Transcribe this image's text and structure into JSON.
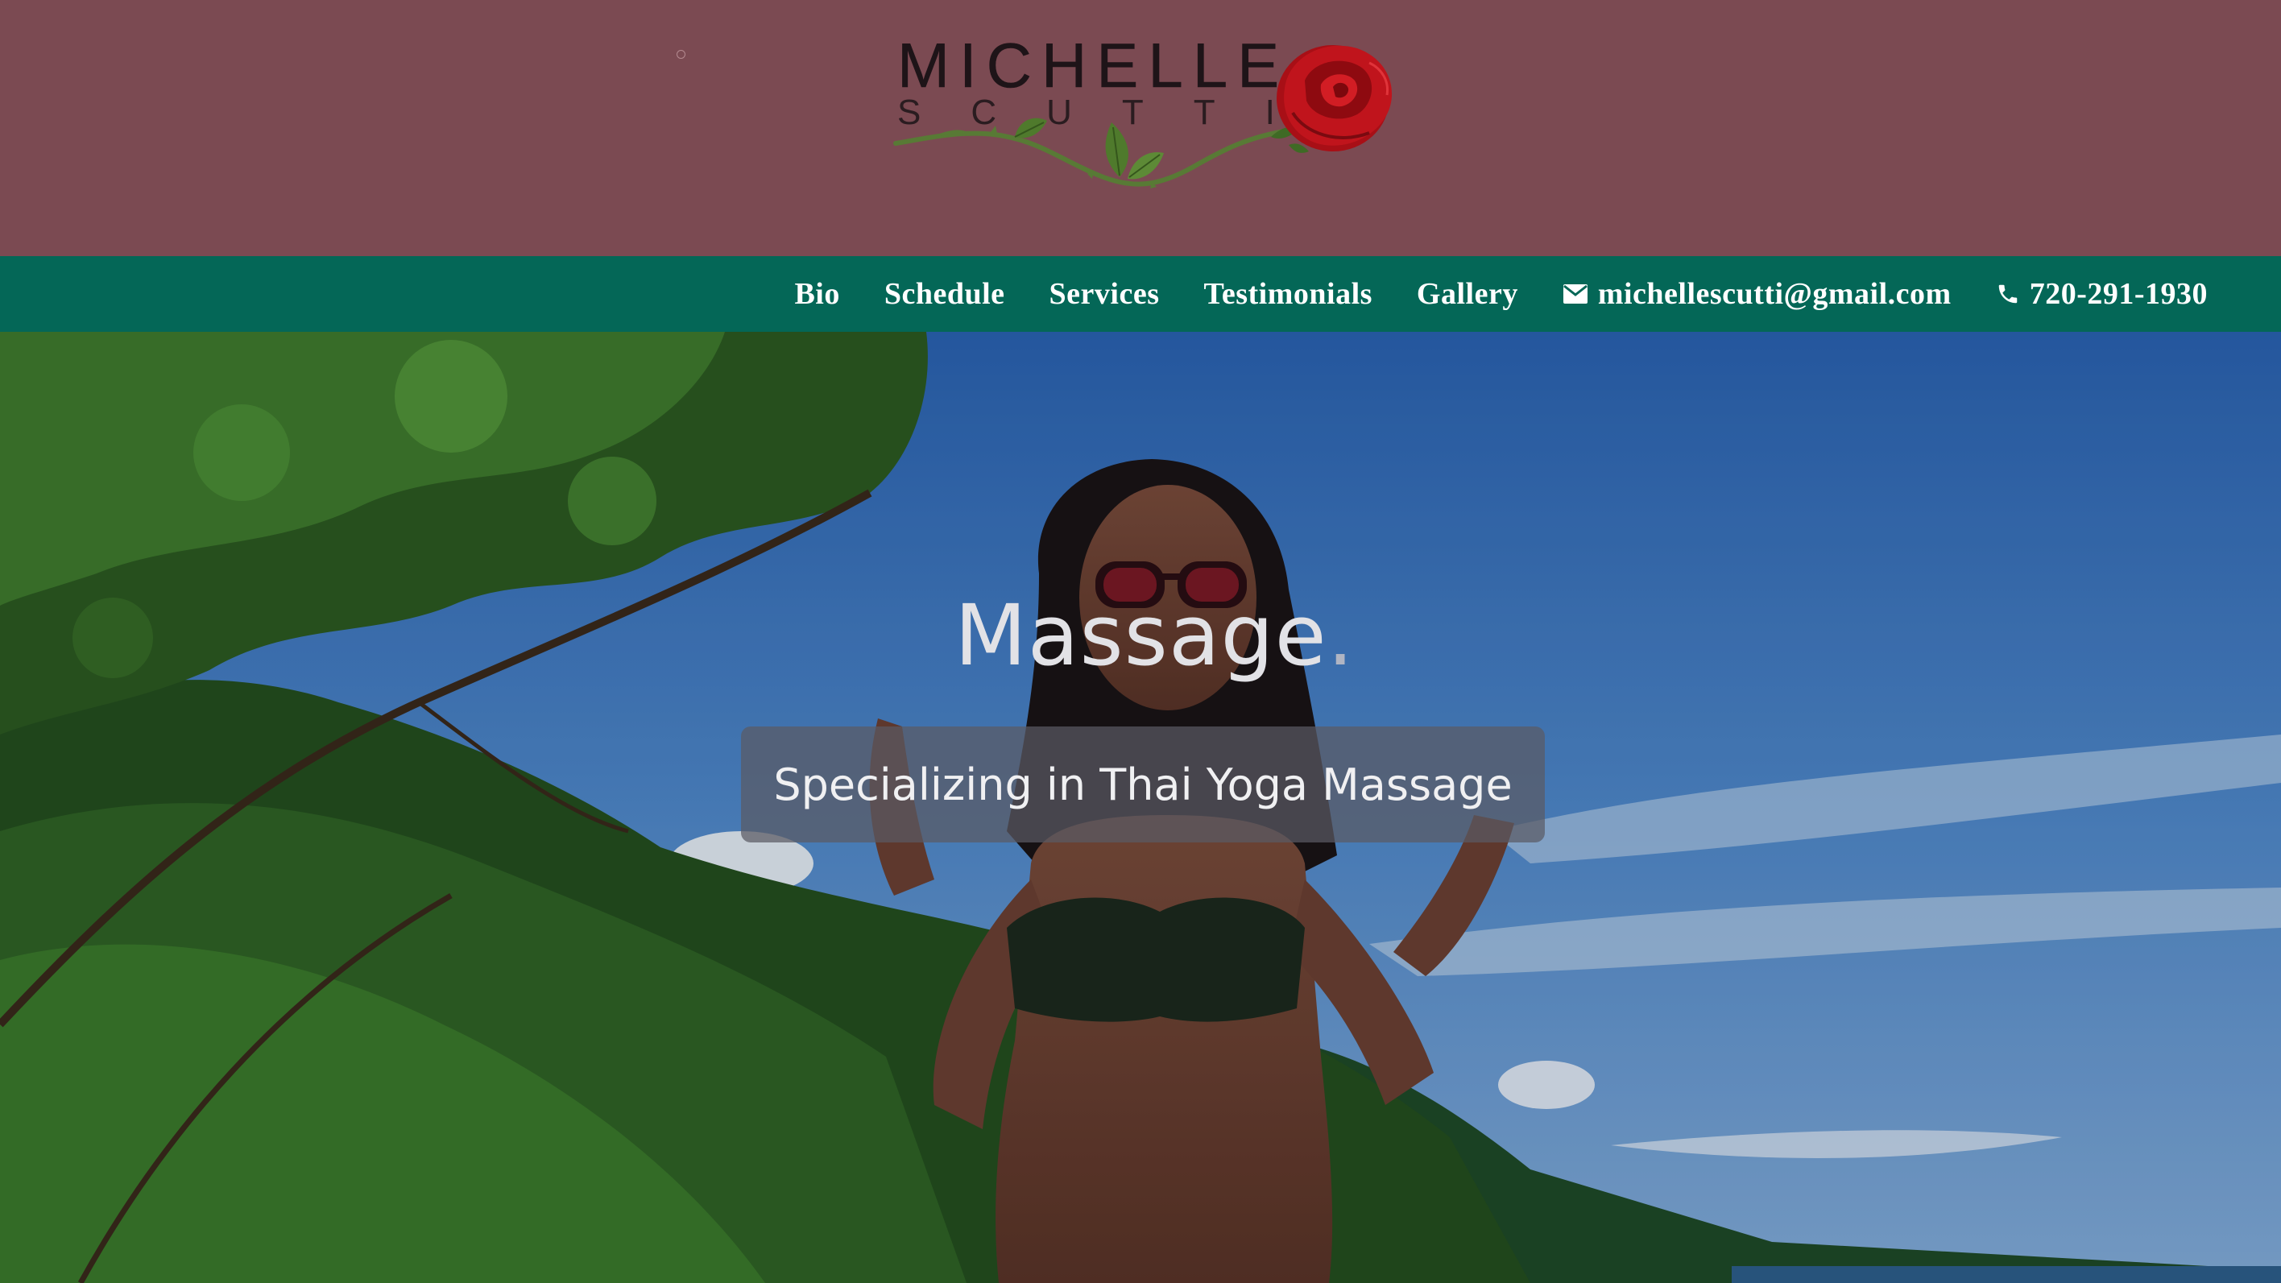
{
  "header": {
    "logo": {
      "first_name": "MICHELLE",
      "last_name": "SCUTTI",
      "icon": "rose-icon"
    }
  },
  "nav": {
    "items": [
      {
        "label": "Bio"
      },
      {
        "label": "Schedule"
      },
      {
        "label": "Services"
      },
      {
        "label": "Testimonials"
      },
      {
        "label": "Gallery"
      }
    ],
    "email": {
      "icon": "mail-icon",
      "label": "michellescutti@gmail.com"
    },
    "phone": {
      "icon": "phone-icon",
      "label": "720-291-1930"
    }
  },
  "hero": {
    "title": "Massage",
    "title_dot": ".",
    "subtitle": "Specializing in Thai Yoga Massage"
  },
  "colors": {
    "header_bg": "#7b4a52",
    "nav_bg": "#046757",
    "nav_text": "#ffffff",
    "rose": "#c0141c",
    "leaf": "#4f7a2c"
  }
}
